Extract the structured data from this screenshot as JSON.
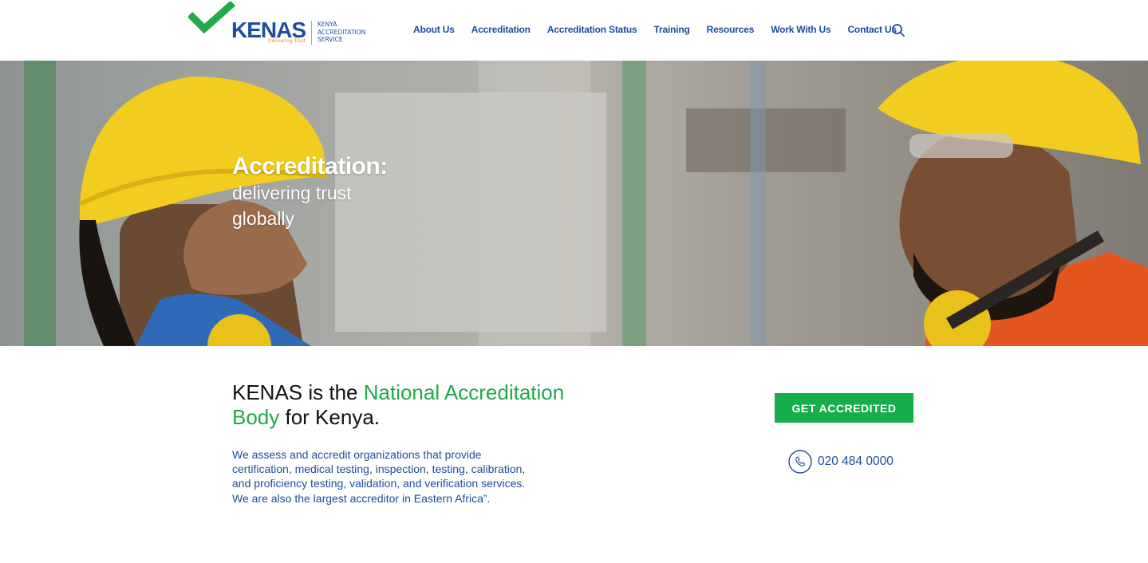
{
  "brand": {
    "name": "KENAS",
    "tagline": "Delivering Trust",
    "side_text": [
      "KENYA",
      "ACCREDITATION",
      "SERVICE"
    ],
    "colors": {
      "primary_blue": "#1f4b99",
      "accent_green": "#22a94a",
      "cta_green": "#16ad4b"
    }
  },
  "nav": {
    "items": [
      {
        "label": "About Us"
      },
      {
        "label": "Accreditation"
      },
      {
        "label": "Accreditation Status"
      },
      {
        "label": "Training"
      },
      {
        "label": "Resources"
      },
      {
        "label": "Work With Us"
      },
      {
        "label": "Contact Us"
      }
    ],
    "search_icon": "search-icon"
  },
  "hero": {
    "title": "Accreditation:",
    "subtitle": "delivering trust globally",
    "image": "two engineers in yellow hard hats facing each other"
  },
  "intro": {
    "heading_part1": "KENAS is the ",
    "heading_accent": "National Accreditation Body",
    "heading_part2": " for Kenya.",
    "body": "We assess and accredit organizations that provide certification, medical testing, inspection, testing, calibration, and proficiency testing, validation, and verification services. We are also the largest accreditor in Eastern Africa”."
  },
  "cta": {
    "label": "GET ACCREDITED"
  },
  "contact": {
    "phone": "020 484 0000",
    "phone_icon": "phone-icon"
  }
}
